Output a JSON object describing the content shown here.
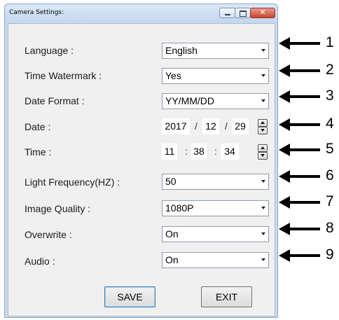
{
  "window": {
    "title": "Camera Settings:"
  },
  "fields": {
    "language": {
      "label": "Language :",
      "value": "English"
    },
    "watermark": {
      "label": "Time Watermark :",
      "value": "Yes"
    },
    "date_format": {
      "label": "Date Format :",
      "value": "YY/MM/DD"
    },
    "date": {
      "label": "Date :",
      "year": "2017",
      "month": "12",
      "day": "29",
      "sep": "/"
    },
    "time": {
      "label": "Time :",
      "hour": "11",
      "minute": "38",
      "second": "34",
      "sep": ":"
    },
    "light_freq": {
      "label": "Light Frequency(HZ) :",
      "value": "50"
    },
    "quality": {
      "label": "Image Quality :",
      "value": "1080P"
    },
    "overwrite": {
      "label": "Overwrite :",
      "value": "On"
    },
    "audio": {
      "label": "Audio :",
      "value": "On"
    }
  },
  "buttons": {
    "save": "SAVE",
    "exit": "EXIT"
  },
  "annotations": [
    "1",
    "2",
    "3",
    "4",
    "5",
    "6",
    "7",
    "8",
    "9"
  ],
  "colors": {
    "close_button": "#c9432f",
    "panel": "#f0f0f0",
    "frame": "#c9daf0"
  }
}
